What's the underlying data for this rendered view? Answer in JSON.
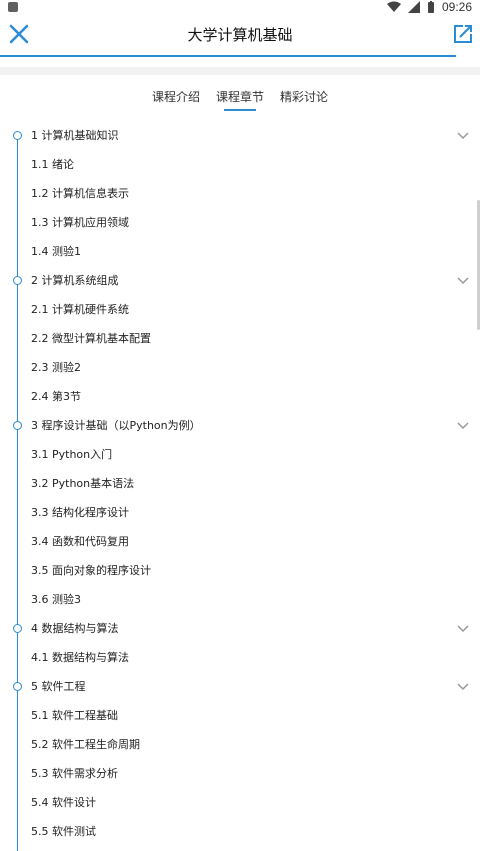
{
  "status_bar": {
    "time": "09:26",
    "icons": [
      "wifi-icon",
      "signal-icon",
      "battery-icon"
    ]
  },
  "header": {
    "title": "大学计算机基础",
    "close_icon": "close-icon",
    "share_icon": "share-icon",
    "accent_color": "#2a8bd6"
  },
  "tabs": [
    {
      "label": "课程介绍",
      "active": false
    },
    {
      "label": "课程章节",
      "active": true
    },
    {
      "label": "精彩讨论",
      "active": false
    }
  ],
  "chapters": [
    {
      "label": "1 计算机基础知识",
      "sections": [
        "1.1 绪论",
        "1.2 计算机信息表示",
        "1.3 计算机应用领域",
        "1.4 测验1"
      ]
    },
    {
      "label": "2 计算机系统组成",
      "sections": [
        "2.1 计算机硬件系统",
        "2.2 微型计算机基本配置",
        "2.3 测验2",
        "2.4 第3节"
      ]
    },
    {
      "label": "3 程序设计基础（以Python为例）",
      "sections": [
        "3.1 Python入门",
        "3.2 Python基本语法",
        "3.3 结构化程序设计",
        "3.4 函数和代码复用",
        "3.5 面向对象的程序设计",
        "3.6 测验3"
      ]
    },
    {
      "label": "4 数据结构与算法",
      "sections": [
        "4.1 数据结构与算法"
      ]
    },
    {
      "label": "5 软件工程",
      "sections": [
        "5.1 软件工程基础",
        "5.2 软件工程生命周期",
        "5.3 软件需求分析",
        "5.4 软件设计",
        "5.5 软件测试"
      ]
    }
  ]
}
